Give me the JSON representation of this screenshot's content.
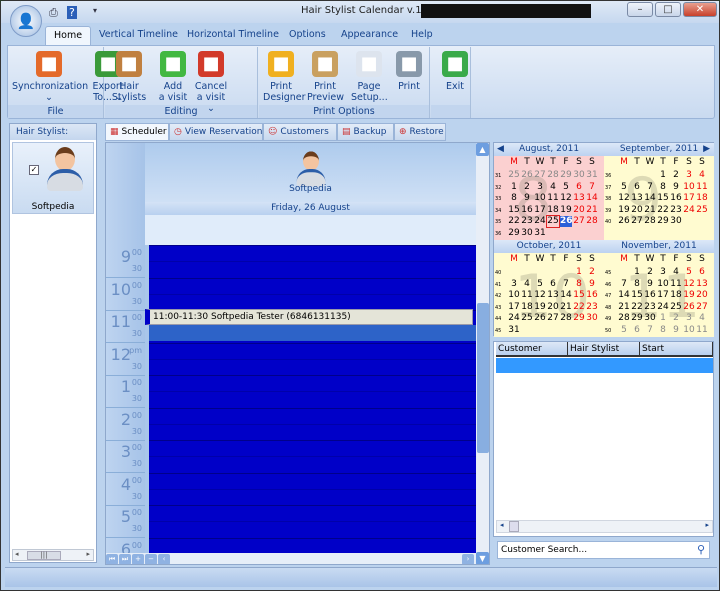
{
  "window": {
    "title": "Hair Stylist Calendar v.1.3"
  },
  "ribbon": {
    "tabs": [
      "Home",
      "Vertical Timeline",
      "Horizontal Timeline",
      "Options",
      "Appearance",
      "Help"
    ],
    "groups": [
      {
        "label": "File",
        "buttons": [
          {
            "label": "Synchronization",
            "sub": "⌄",
            "icon": "sync-calendar-icon"
          },
          {
            "label": "Export",
            "sub": "To... ⌄",
            "icon": "export-icon"
          }
        ]
      },
      {
        "label": "Editing",
        "buttons": [
          {
            "label": "Hair",
            "sub": "Stylists",
            "icon": "stylists-icon"
          },
          {
            "label": "Add",
            "sub": "a visit",
            "icon": "add-icon"
          },
          {
            "label": "Cancel",
            "sub": "a visit ⌄",
            "icon": "cancel-icon"
          }
        ]
      },
      {
        "label": "Print Options",
        "buttons": [
          {
            "label": "Print",
            "sub": "Designer",
            "icon": "gear-icon"
          },
          {
            "label": "Print",
            "sub": "Preview",
            "icon": "magnifier-icon"
          },
          {
            "label": "Page",
            "sub": "Setup...",
            "icon": "pages-icon"
          },
          {
            "label": "Print",
            "sub": "",
            "icon": "printer-icon"
          }
        ]
      },
      {
        "label": "",
        "buttons": [
          {
            "label": "Exit",
            "sub": "",
            "icon": "exit-door-icon"
          }
        ]
      }
    ]
  },
  "left_panel": {
    "header": "Hair Stylist:",
    "stylist": {
      "name": "Softpedia",
      "checked": true
    }
  },
  "tabs": [
    {
      "label": "Scheduler",
      "icon": "calendar-grid-icon",
      "active": true
    },
    {
      "label": "View Reservations",
      "icon": "clock-icon"
    },
    {
      "label": "Customers",
      "icon": "customers-icon"
    },
    {
      "label": "Backup",
      "icon": "disk-icon"
    },
    {
      "label": "Restore",
      "icon": "lifebuoy-icon"
    }
  ],
  "scheduler": {
    "resource": "Softpedia",
    "date": "Friday, 26 August",
    "hours": [
      {
        "h": "9",
        "s": "00"
      },
      {
        "h": "10",
        "s": "00"
      },
      {
        "h": "11",
        "s": "00"
      },
      {
        "h": "12",
        "s": "pm"
      },
      {
        "h": "1",
        "s": "00"
      },
      {
        "h": "2",
        "s": "00"
      },
      {
        "h": "3",
        "s": "00"
      },
      {
        "h": "4",
        "s": "00"
      },
      {
        "h": "5",
        "s": "00"
      },
      {
        "h": "6",
        "s": "00"
      }
    ],
    "half": "30",
    "appointment": "11:00-11:30 Softpedia Tester (6846131135)",
    "grid_color": "#0000c8"
  },
  "calendars": {
    "dow": [
      "M",
      "T",
      "W",
      "T",
      "F",
      "S",
      "S"
    ],
    "selected": {
      "month": 0,
      "day": 26
    },
    "today": {
      "month": 0,
      "day": 25
    },
    "months": [
      {
        "title": "August, 2011",
        "watermark": "8",
        "weeks": [
          31,
          32,
          33,
          34,
          35,
          36
        ],
        "rows": [
          [
            25,
            26,
            27,
            28,
            29,
            30,
            31
          ],
          [
            1,
            2,
            3,
            4,
            5,
            6,
            7
          ],
          [
            8,
            9,
            10,
            11,
            12,
            13,
            14
          ],
          [
            15,
            16,
            17,
            18,
            19,
            20,
            21
          ],
          [
            22,
            23,
            24,
            25,
            26,
            27,
            28
          ],
          [
            29,
            30,
            31,
            null,
            null,
            null,
            null
          ]
        ]
      },
      {
        "title": "September, 2011",
        "watermark": "9",
        "weeks": [
          36,
          37,
          38,
          39,
          40
        ],
        "rows": [
          [
            null,
            null,
            null,
            1,
            2,
            3,
            4
          ],
          [
            5,
            6,
            7,
            8,
            9,
            10,
            11
          ],
          [
            12,
            13,
            14,
            15,
            16,
            17,
            18
          ],
          [
            19,
            20,
            21,
            22,
            23,
            24,
            25
          ],
          [
            26,
            27,
            28,
            29,
            30,
            null,
            null
          ]
        ]
      },
      {
        "title": "October, 2011",
        "watermark": "10",
        "weeks": [
          40,
          41,
          42,
          43,
          44,
          45
        ],
        "rows": [
          [
            null,
            null,
            null,
            null,
            null,
            1,
            2
          ],
          [
            3,
            4,
            5,
            6,
            7,
            8,
            9
          ],
          [
            10,
            11,
            12,
            13,
            14,
            15,
            16
          ],
          [
            17,
            18,
            19,
            20,
            21,
            22,
            23
          ],
          [
            24,
            25,
            26,
            27,
            28,
            29,
            30
          ],
          [
            31,
            null,
            null,
            null,
            null,
            null,
            null
          ]
        ]
      },
      {
        "title": "November, 2011",
        "watermark": "11",
        "weeks": [
          45,
          46,
          47,
          48,
          49,
          50
        ],
        "rows": [
          [
            null,
            1,
            2,
            3,
            4,
            5,
            6
          ],
          [
            7,
            8,
            9,
            10,
            11,
            12,
            13
          ],
          [
            14,
            15,
            16,
            17,
            18,
            19,
            20
          ],
          [
            21,
            22,
            23,
            24,
            25,
            26,
            27
          ],
          [
            28,
            29,
            30,
            1,
            2,
            3,
            4
          ],
          [
            5,
            6,
            7,
            8,
            9,
            10,
            11
          ]
        ]
      }
    ]
  },
  "reservations": {
    "columns": [
      "Customer",
      "Hair Stylist",
      "Start"
    ]
  },
  "search": {
    "placeholder": "Customer Search..."
  }
}
